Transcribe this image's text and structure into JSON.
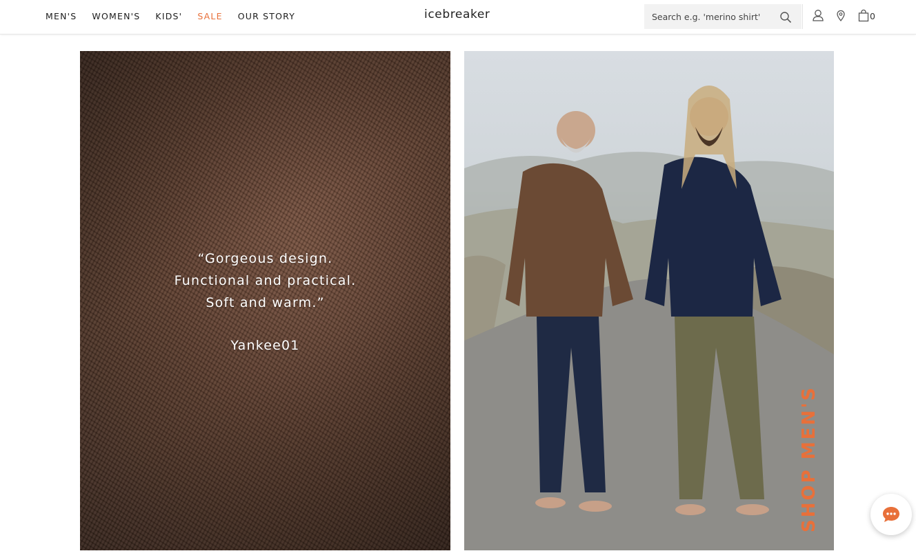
{
  "header": {
    "nav": [
      {
        "label": "MEN'S"
      },
      {
        "label": "WOMEN'S"
      },
      {
        "label": "KIDS'"
      },
      {
        "label": "SALE"
      },
      {
        "label": "OUR STORY"
      }
    ],
    "logo": "icebreaker",
    "search": {
      "placeholder": "Search e.g. 'merino shirt'",
      "icon": "search-icon"
    },
    "icons": [
      "account-icon",
      "location-pin-icon",
      "shopping-bag-icon"
    ],
    "cart_count": "0"
  },
  "left_panel": {
    "quote_lines": [
      "“Gorgeous design.",
      "Functional and practical.",
      "Soft and warm.”"
    ],
    "author": "Yankee01"
  },
  "right_panel": {
    "cta": "SHOP MEN'S"
  },
  "chat": {
    "icon": "chat-bubble-icon"
  },
  "colors": {
    "accent_orange": "#e8703a",
    "text": "#1d1d1d",
    "search_bg": "#f2f2f2"
  }
}
